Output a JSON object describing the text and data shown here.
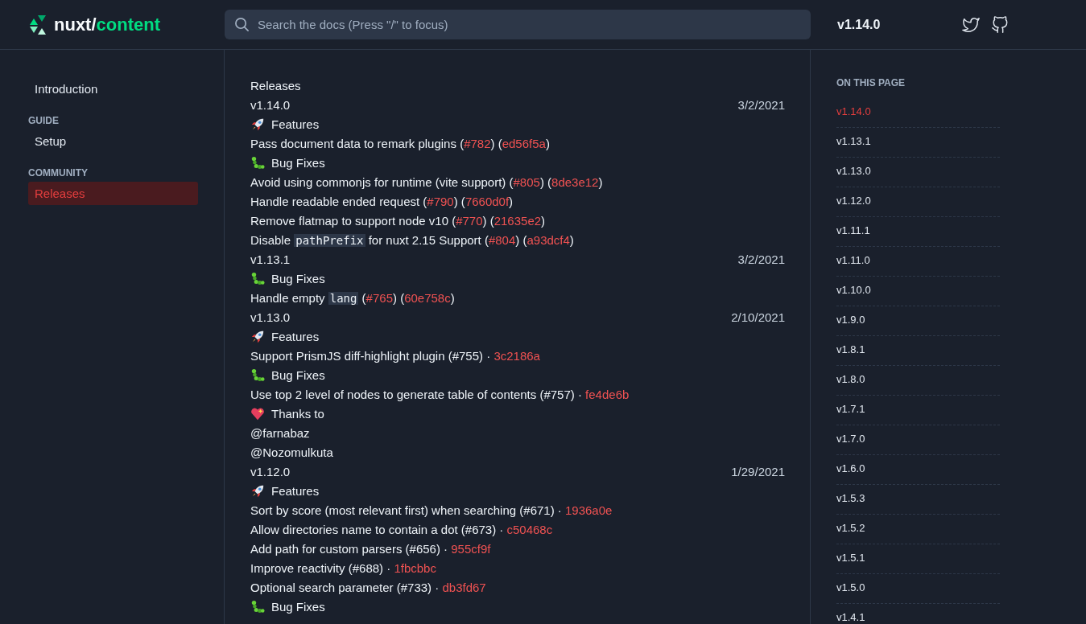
{
  "header": {
    "logo_left": "nuxt/",
    "logo_right": "content",
    "search": {
      "placeholder": "Search the docs (Press \"/\" to focus)"
    },
    "version": "v1.14.0"
  },
  "sidebar": [
    {
      "kind": "link",
      "label": "Introduction",
      "selected": false
    },
    {
      "kind": "heading",
      "label": "GUIDE"
    },
    {
      "kind": "link",
      "label": "Setup",
      "selected": false
    },
    {
      "kind": "heading",
      "label": "COMMUNITY"
    },
    {
      "kind": "link",
      "label": "Releases",
      "selected": true
    }
  ],
  "content": [
    {
      "kind": "title",
      "text": "Releases"
    },
    {
      "kind": "version",
      "text": "v1.14.0",
      "date": "3/2/2021"
    },
    {
      "kind": "features",
      "text": "Features"
    },
    {
      "kind": "item",
      "parts": [
        {
          "kind": "text",
          "text": "Pass document data to remark plugins ("
        },
        {
          "kind": "link",
          "text": "#782"
        },
        {
          "kind": "text",
          "text": ") ("
        },
        {
          "kind": "link",
          "text": "ed56f5a"
        },
        {
          "kind": "text",
          "text": ")"
        }
      ]
    },
    {
      "kind": "fixes",
      "text": "Bug Fixes"
    },
    {
      "kind": "item",
      "parts": [
        {
          "kind": "text",
          "text": "Avoid using commonjs for runtime (vite support) ("
        },
        {
          "kind": "link",
          "text": "#805"
        },
        {
          "kind": "text",
          "text": ") ("
        },
        {
          "kind": "link",
          "text": "8de3e12"
        },
        {
          "kind": "text",
          "text": ")"
        }
      ]
    },
    {
      "kind": "item",
      "parts": [
        {
          "kind": "text",
          "text": "Handle readable ended request ("
        },
        {
          "kind": "link",
          "text": "#790"
        },
        {
          "kind": "text",
          "text": ") ("
        },
        {
          "kind": "link",
          "text": "7660d0f"
        },
        {
          "kind": "text",
          "text": ")"
        }
      ]
    },
    {
      "kind": "item",
      "parts": [
        {
          "kind": "text",
          "text": "Remove flatmap to support node v10 ("
        },
        {
          "kind": "link",
          "text": "#770"
        },
        {
          "kind": "text",
          "text": ") ("
        },
        {
          "kind": "link",
          "text": "21635e2"
        },
        {
          "kind": "text",
          "text": ")"
        }
      ]
    },
    {
      "kind": "item",
      "parts": [
        {
          "kind": "text",
          "text": "Disable "
        },
        {
          "kind": "code",
          "text": "pathPrefix"
        },
        {
          "kind": "text",
          "text": " for nuxt 2.15 Support ("
        },
        {
          "kind": "link",
          "text": "#804"
        },
        {
          "kind": "text",
          "text": ") ("
        },
        {
          "kind": "link",
          "text": "a93dcf4"
        },
        {
          "kind": "text",
          "text": ")"
        }
      ]
    },
    {
      "kind": "version",
      "text": "v1.13.1",
      "date": "3/2/2021"
    },
    {
      "kind": "fixes",
      "text": "Bug Fixes"
    },
    {
      "kind": "item",
      "parts": [
        {
          "kind": "text",
          "text": "Handle empty "
        },
        {
          "kind": "code",
          "text": "lang"
        },
        {
          "kind": "text",
          "text": " ("
        },
        {
          "kind": "link",
          "text": "#765"
        },
        {
          "kind": "text",
          "text": ") ("
        },
        {
          "kind": "link",
          "text": "60e758c"
        },
        {
          "kind": "text",
          "text": ")"
        }
      ]
    },
    {
      "kind": "version",
      "text": "v1.13.0",
      "date": "2/10/2021"
    },
    {
      "kind": "features",
      "text": "Features"
    },
    {
      "kind": "item",
      "parts": [
        {
          "kind": "text",
          "text": "Support PrismJS diff-highlight plugin (#755) · "
        },
        {
          "kind": "link",
          "text": "3c2186a"
        }
      ]
    },
    {
      "kind": "fixes",
      "text": "Bug Fixes"
    },
    {
      "kind": "item",
      "parts": [
        {
          "kind": "text",
          "text": "Use top 2 level of nodes to generate table of contents (#757) · "
        },
        {
          "kind": "link",
          "text": "fe4de6b"
        }
      ]
    },
    {
      "kind": "thanks",
      "text": "Thanks to"
    },
    {
      "kind": "mention",
      "text": "@farnabaz"
    },
    {
      "kind": "mention",
      "text": "@Nozomulkuta"
    },
    {
      "kind": "version",
      "text": "v1.12.0",
      "date": "1/29/2021"
    },
    {
      "kind": "features",
      "text": "Features"
    },
    {
      "kind": "item",
      "parts": [
        {
          "kind": "text",
          "text": "Sort by score (most relevant first) when searching (#671) · "
        },
        {
          "kind": "link",
          "text": "1936a0e"
        }
      ]
    },
    {
      "kind": "item",
      "parts": [
        {
          "kind": "text",
          "text": "Allow directories name to contain a dot (#673) · "
        },
        {
          "kind": "link",
          "text": "c50468c"
        }
      ]
    },
    {
      "kind": "item",
      "parts": [
        {
          "kind": "text",
          "text": "Add path for custom parsers (#656) · "
        },
        {
          "kind": "link",
          "text": "955cf9f"
        }
      ]
    },
    {
      "kind": "item",
      "parts": [
        {
          "kind": "text",
          "text": "Improve reactivity (#688) · "
        },
        {
          "kind": "link",
          "text": "1fbcbbc"
        }
      ]
    },
    {
      "kind": "item",
      "parts": [
        {
          "kind": "text",
          "text": "Optional search parameter (#733) · "
        },
        {
          "kind": "link",
          "text": "db3fd67"
        }
      ]
    },
    {
      "kind": "fixes",
      "text": "Bug Fixes"
    }
  ],
  "toc": {
    "heading": "ON THIS PAGE",
    "items": [
      {
        "label": "v1.14.0",
        "selected": true
      },
      {
        "label": "v1.13.1",
        "selected": false
      },
      {
        "label": "v1.13.0",
        "selected": false
      },
      {
        "label": "v1.12.0",
        "selected": false
      },
      {
        "label": "v1.11.1",
        "selected": false
      },
      {
        "label": "v1.11.0",
        "selected": false
      },
      {
        "label": "v1.10.0",
        "selected": false
      },
      {
        "label": "v1.9.0",
        "selected": false
      },
      {
        "label": "v1.8.1",
        "selected": false
      },
      {
        "label": "v1.8.0",
        "selected": false
      },
      {
        "label": "v1.7.1",
        "selected": false
      },
      {
        "label": "v1.7.0",
        "selected": false
      },
      {
        "label": "v1.6.0",
        "selected": false
      },
      {
        "label": "v1.5.3",
        "selected": false
      },
      {
        "label": "v1.5.2",
        "selected": false
      },
      {
        "label": "v1.5.1",
        "selected": false
      },
      {
        "label": "v1.5.0",
        "selected": false
      },
      {
        "label": "v1.4.1",
        "selected": false
      }
    ]
  }
}
